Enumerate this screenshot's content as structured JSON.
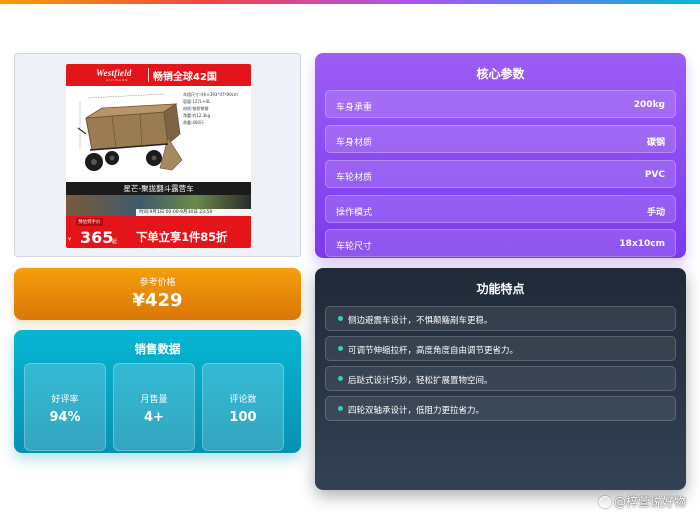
{
  "product_image": {
    "brand": "Westfield",
    "brand_sub": "OUTDOOR",
    "slogan": "畅销全球42国",
    "specs": [
      "车组尺寸:(H)×393*47*90cm",
      "容量:127L+4L",
      "材质:铁质铁钢",
      "净重:约12.3kg",
      "承重:400斤"
    ],
    "title": "星芒-聚拢翻斗露营车",
    "time": "时间:9月1日 00:00-9月30日 23:59",
    "pre_label": "预估到手价",
    "pre_price": "365",
    "pre_yuan": "¥",
    "pre_unit": "起",
    "deal": "下单立享1件85折"
  },
  "price": {
    "label": "参考价格",
    "value": "¥429"
  },
  "sales": {
    "title": "销售数据",
    "stats": [
      {
        "label": "好评率",
        "value": "94%"
      },
      {
        "label": "月售量",
        "value": "4+"
      },
      {
        "label": "评论数",
        "value": "100"
      }
    ]
  },
  "params": {
    "title": "核心参数",
    "rows": [
      {
        "name": "车身承重",
        "value": "200kg"
      },
      {
        "name": "车身材质",
        "value": "碳钢"
      },
      {
        "name": "车轮材质",
        "value": "PVC"
      },
      {
        "name": "操作模式",
        "value": "手动"
      },
      {
        "name": "车轮尺寸",
        "value": "18x10cm"
      }
    ]
  },
  "features": {
    "title": "功能特点",
    "items": [
      "侧边避震车设计，不惧颠簸剐车更稳。",
      "可调节伸缩拉杆，高度角度自由调节更省力。",
      "后跶式设计巧妙，轻松扩展置物空间。",
      "四轮双轴承设计，低阻力更拉省力。"
    ]
  },
  "watermark": "@梓萱说好物",
  "colors": {
    "price_card": "#f59e0b",
    "sales_card": "#06b6d4",
    "params_card": "#8b5cf6",
    "features_card": "#1f2937",
    "poster_red": "#e4141b"
  }
}
